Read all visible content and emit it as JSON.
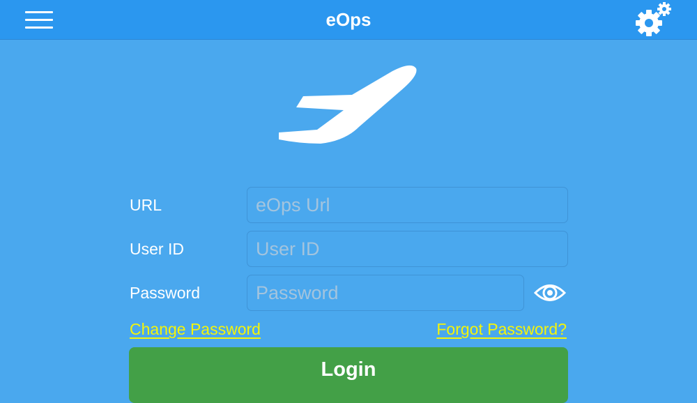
{
  "header": {
    "title": "eOps",
    "menu_icon": "hamburger-menu-icon",
    "settings_icon": "gears-icon"
  },
  "logo": {
    "icon": "airplane-takeoff-icon"
  },
  "form": {
    "url_label": "URL",
    "url_placeholder": "eOps Url",
    "url_value": "",
    "userid_label": "User ID",
    "userid_placeholder": "User ID",
    "userid_value": "",
    "password_label": "Password",
    "password_placeholder": "Password",
    "password_value": "",
    "show_password_icon": "eye-icon"
  },
  "links": {
    "change_password": "Change Password",
    "forgot_password": "Forgot Password?"
  },
  "login_button": "Login",
  "colors": {
    "background": "#4aa8ee",
    "header": "#2b97ef",
    "link": "#f4f40a",
    "login_button": "#43a047"
  }
}
